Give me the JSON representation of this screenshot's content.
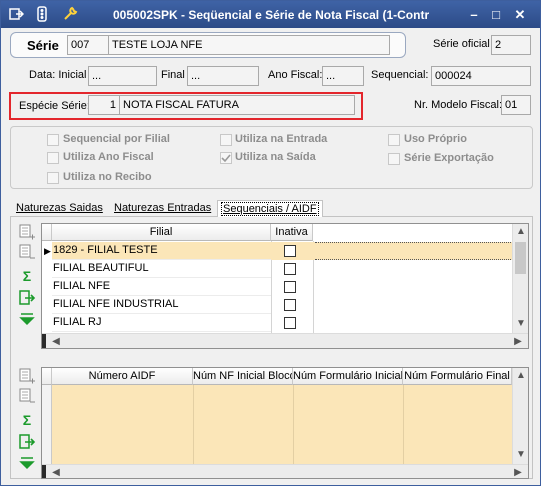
{
  "window": {
    "title": "005002SPK - Seqüencial e Série de Nota Fiscal (1-Contr",
    "icons": [
      "save-exit-icon",
      "traffic-light-icon",
      "wrench-icon"
    ],
    "controls": [
      "minimize",
      "maximize",
      "close"
    ]
  },
  "serie": {
    "label": "Série",
    "code": "007",
    "description": "TESTE LOJA NFE",
    "official_label": "Série oficial",
    "official_value": "2"
  },
  "dates": {
    "inicial_label": "Data: Inicial",
    "inicial_value": "...",
    "final_label": "Final",
    "final_value": "...",
    "ano_label": "Ano Fiscal:",
    "ano_value": "...",
    "sequencial_label": "Sequencial:",
    "sequencial_value": "000024"
  },
  "especie": {
    "label": "Espécie Série:",
    "code": "1",
    "description": "NOTA FISCAL FATURA",
    "modelo_label": "Nr. Modelo Fiscal:",
    "modelo_value": "01"
  },
  "options": {
    "seq_filial": "Sequencial por Filial",
    "ano_fiscal": "Utiliza Ano Fiscal",
    "recibo": "Utiliza no Recibo",
    "entrada": "Utiliza na Entrada",
    "saida": "Utiliza na Saída",
    "uso_proprio": "Uso Próprio",
    "exportacao": "Série Exportação",
    "saida_checked": true
  },
  "tabs": [
    "Naturezas Saidas",
    "Naturezas Entradas",
    "Sequenciais / AIDF"
  ],
  "active_tab": "Sequenciais / AIDF",
  "filial_grid": {
    "columns": [
      "Filial",
      "Inativa"
    ],
    "rows": [
      {
        "filial": "1829 - FILIAL TESTE",
        "inativa": false,
        "selected": true
      },
      {
        "filial": "FILIAL BEAUTIFUL",
        "inativa": false
      },
      {
        "filial": "FILIAL NFE",
        "inativa": false
      },
      {
        "filial": "FILIAL NFE INDUSTRIAL",
        "inativa": false
      },
      {
        "filial": "FILIAL RJ",
        "inativa": false
      }
    ]
  },
  "aidf_grid": {
    "columns": [
      "Número AIDF",
      "Núm NF Inicial Bloco",
      "Núm Formulário Inicial",
      "Núm Formulário Final"
    ]
  },
  "toolbar_icons": [
    "add-row-icon",
    "remove-row-icon",
    "sum-icon",
    "export-icon",
    "filter-icon"
  ]
}
